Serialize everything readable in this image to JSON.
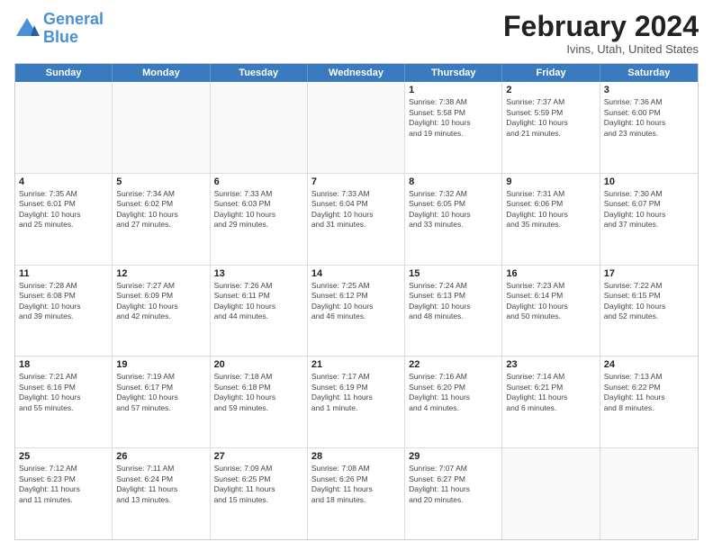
{
  "header": {
    "logo_line1": "General",
    "logo_line2": "Blue",
    "month": "February 2024",
    "location": "Ivins, Utah, United States"
  },
  "weekdays": [
    "Sunday",
    "Monday",
    "Tuesday",
    "Wednesday",
    "Thursday",
    "Friday",
    "Saturday"
  ],
  "rows": [
    [
      {
        "day": "",
        "info": ""
      },
      {
        "day": "",
        "info": ""
      },
      {
        "day": "",
        "info": ""
      },
      {
        "day": "",
        "info": ""
      },
      {
        "day": "1",
        "info": "Sunrise: 7:38 AM\nSunset: 5:58 PM\nDaylight: 10 hours\nand 19 minutes."
      },
      {
        "day": "2",
        "info": "Sunrise: 7:37 AM\nSunset: 5:59 PM\nDaylight: 10 hours\nand 21 minutes."
      },
      {
        "day": "3",
        "info": "Sunrise: 7:36 AM\nSunset: 6:00 PM\nDaylight: 10 hours\nand 23 minutes."
      }
    ],
    [
      {
        "day": "4",
        "info": "Sunrise: 7:35 AM\nSunset: 6:01 PM\nDaylight: 10 hours\nand 25 minutes."
      },
      {
        "day": "5",
        "info": "Sunrise: 7:34 AM\nSunset: 6:02 PM\nDaylight: 10 hours\nand 27 minutes."
      },
      {
        "day": "6",
        "info": "Sunrise: 7:33 AM\nSunset: 6:03 PM\nDaylight: 10 hours\nand 29 minutes."
      },
      {
        "day": "7",
        "info": "Sunrise: 7:33 AM\nSunset: 6:04 PM\nDaylight: 10 hours\nand 31 minutes."
      },
      {
        "day": "8",
        "info": "Sunrise: 7:32 AM\nSunset: 6:05 PM\nDaylight: 10 hours\nand 33 minutes."
      },
      {
        "day": "9",
        "info": "Sunrise: 7:31 AM\nSunset: 6:06 PM\nDaylight: 10 hours\nand 35 minutes."
      },
      {
        "day": "10",
        "info": "Sunrise: 7:30 AM\nSunset: 6:07 PM\nDaylight: 10 hours\nand 37 minutes."
      }
    ],
    [
      {
        "day": "11",
        "info": "Sunrise: 7:28 AM\nSunset: 6:08 PM\nDaylight: 10 hours\nand 39 minutes."
      },
      {
        "day": "12",
        "info": "Sunrise: 7:27 AM\nSunset: 6:09 PM\nDaylight: 10 hours\nand 42 minutes."
      },
      {
        "day": "13",
        "info": "Sunrise: 7:26 AM\nSunset: 6:11 PM\nDaylight: 10 hours\nand 44 minutes."
      },
      {
        "day": "14",
        "info": "Sunrise: 7:25 AM\nSunset: 6:12 PM\nDaylight: 10 hours\nand 46 minutes."
      },
      {
        "day": "15",
        "info": "Sunrise: 7:24 AM\nSunset: 6:13 PM\nDaylight: 10 hours\nand 48 minutes."
      },
      {
        "day": "16",
        "info": "Sunrise: 7:23 AM\nSunset: 6:14 PM\nDaylight: 10 hours\nand 50 minutes."
      },
      {
        "day": "17",
        "info": "Sunrise: 7:22 AM\nSunset: 6:15 PM\nDaylight: 10 hours\nand 52 minutes."
      }
    ],
    [
      {
        "day": "18",
        "info": "Sunrise: 7:21 AM\nSunset: 6:16 PM\nDaylight: 10 hours\nand 55 minutes."
      },
      {
        "day": "19",
        "info": "Sunrise: 7:19 AM\nSunset: 6:17 PM\nDaylight: 10 hours\nand 57 minutes."
      },
      {
        "day": "20",
        "info": "Sunrise: 7:18 AM\nSunset: 6:18 PM\nDaylight: 10 hours\nand 59 minutes."
      },
      {
        "day": "21",
        "info": "Sunrise: 7:17 AM\nSunset: 6:19 PM\nDaylight: 11 hours\nand 1 minute."
      },
      {
        "day": "22",
        "info": "Sunrise: 7:16 AM\nSunset: 6:20 PM\nDaylight: 11 hours\nand 4 minutes."
      },
      {
        "day": "23",
        "info": "Sunrise: 7:14 AM\nSunset: 6:21 PM\nDaylight: 11 hours\nand 6 minutes."
      },
      {
        "day": "24",
        "info": "Sunrise: 7:13 AM\nSunset: 6:22 PM\nDaylight: 11 hours\nand 8 minutes."
      }
    ],
    [
      {
        "day": "25",
        "info": "Sunrise: 7:12 AM\nSunset: 6:23 PM\nDaylight: 11 hours\nand 11 minutes."
      },
      {
        "day": "26",
        "info": "Sunrise: 7:11 AM\nSunset: 6:24 PM\nDaylight: 11 hours\nand 13 minutes."
      },
      {
        "day": "27",
        "info": "Sunrise: 7:09 AM\nSunset: 6:25 PM\nDaylight: 11 hours\nand 15 minutes."
      },
      {
        "day": "28",
        "info": "Sunrise: 7:08 AM\nSunset: 6:26 PM\nDaylight: 11 hours\nand 18 minutes."
      },
      {
        "day": "29",
        "info": "Sunrise: 7:07 AM\nSunset: 6:27 PM\nDaylight: 11 hours\nand 20 minutes."
      },
      {
        "day": "",
        "info": ""
      },
      {
        "day": "",
        "info": ""
      }
    ]
  ]
}
